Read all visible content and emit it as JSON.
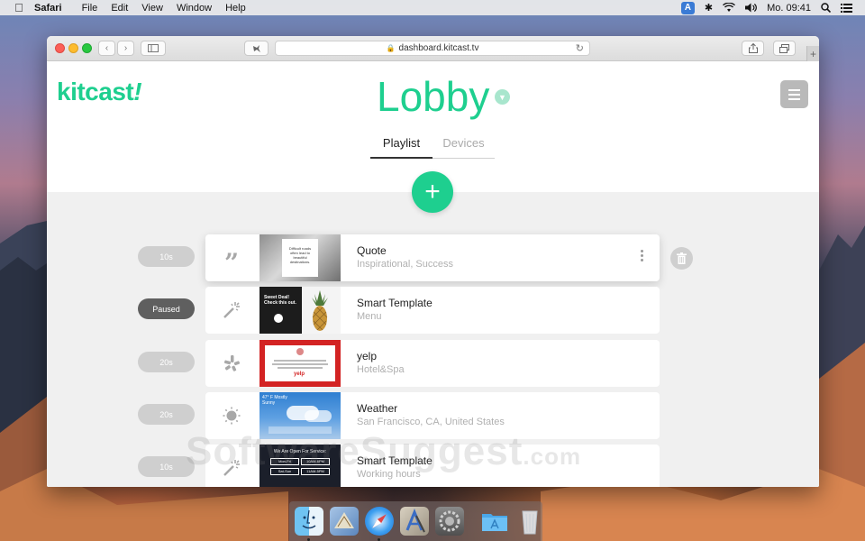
{
  "menubar": {
    "app_name": "Safari",
    "items": [
      "File",
      "Edit",
      "View",
      "Window",
      "Help"
    ],
    "input_indicator": "A",
    "clock": "Mo. 09:41"
  },
  "browser": {
    "url": "dashboard.kitcast.tv",
    "newtab_label": "+"
  },
  "app": {
    "logo_main": "kitcast",
    "logo_bang": "!",
    "title": "Lobby",
    "tabs": [
      {
        "label": "Playlist",
        "active": true
      },
      {
        "label": "Devices",
        "active": false
      }
    ],
    "add_label": "+",
    "accent": "#1ecf8f"
  },
  "playlist": [
    {
      "duration": "10s",
      "title": "Quote",
      "subtitle": "Inspirational, Success",
      "icon": "quote-icon",
      "thumb_text": "Difficult roads often lead to beautiful destinations."
    },
    {
      "duration": "Paused",
      "title": "Smart Template",
      "subtitle": "Menu",
      "icon": "magic-wand-icon",
      "thumb_text": "Sweet Deal! Check this out."
    },
    {
      "duration": "20s",
      "title": "yelp",
      "subtitle": "Hotel&Spa",
      "icon": "yelp-icon",
      "thumb_text": "yelp"
    },
    {
      "duration": "20s",
      "title": "Weather",
      "subtitle": "San Francisco, CA, United States",
      "icon": "sun-icon",
      "thumb_text": "47° F Mostly Sunny"
    },
    {
      "duration": "10s",
      "title": "Smart Template",
      "subtitle": "Working hours",
      "icon": "magic-wand-icon",
      "thumb_text": "We Are Open For Service:",
      "hours": [
        [
          "Mon-Fri",
          "10AM-6PM"
        ],
        [
          "Sat-Sun",
          "11AM-5PM"
        ]
      ]
    }
  ],
  "watermark": {
    "main": "SoftwareSuggest",
    "suffix": ".com"
  },
  "dock": [
    "finder-icon",
    "mail-icon",
    "safari-icon",
    "xcode-icon",
    "system-preferences-icon",
    "applications-folder-icon",
    "trash-icon"
  ]
}
